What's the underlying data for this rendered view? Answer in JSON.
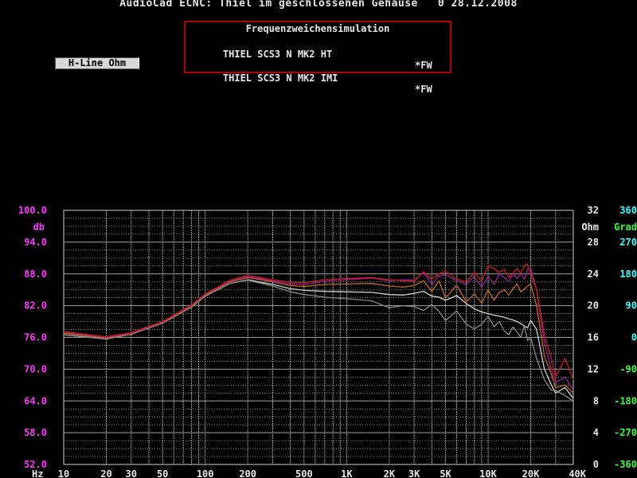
{
  "header": {
    "title": "AudioCad ECNC: Thiel im geschlossenen Gehäuse   0 28.12.2008"
  },
  "legend_box": {
    "heading": "Frequenzweichensimulation",
    "lines": [
      {
        "name": "THIEL SCS3 N MK2 HT",
        "tag": "*FW"
      },
      {
        "name": "THIEL SCS3 N MK2 IMI",
        "tag": "*FW"
      }
    ]
  },
  "toolbar": {
    "hline_label": "H-Line Ohm"
  },
  "colors": {
    "db_axis": "#ff33ff",
    "grad_axis": "#33ffff",
    "grad_neg_axis": "#33ff33",
    "grid": "#9a9a9a",
    "frame": "#d0d0d0",
    "legend_border": "#b00000"
  },
  "chart_data": {
    "type": "line",
    "x_scale": "log",
    "xlim": [
      10,
      40000
    ],
    "x_tick_labels": [
      {
        "value": 10,
        "label": "10"
      },
      {
        "value": 20,
        "label": "20"
      },
      {
        "value": 30,
        "label": "30"
      },
      {
        "value": 50,
        "label": "50"
      },
      {
        "value": 100,
        "label": "100"
      },
      {
        "value": 200,
        "label": "200"
      },
      {
        "value": 500,
        "label": "500"
      },
      {
        "value": 1000,
        "label": "1K"
      },
      {
        "value": 2000,
        "label": "2K"
      },
      {
        "value": 3000,
        "label": "3K"
      },
      {
        "value": 5000,
        "label": "5K"
      },
      {
        "value": 10000,
        "label": "10K"
      },
      {
        "value": 20000,
        "label": "20K"
      },
      {
        "value": 40000,
        "label": "40K"
      }
    ],
    "x_unit": "Hz",
    "ylim": [
      52,
      100
    ],
    "y_ticks": [
      52,
      58,
      64,
      70,
      76,
      82,
      88,
      94,
      100
    ],
    "y_tick_labels": [
      "52.0",
      "58.0",
      "64.0",
      "70.0",
      "76.0",
      "82.0",
      "88.0",
      "94.0",
      "100.0"
    ],
    "ylabel": "db",
    "ohm_axis": {
      "label": "Ohm",
      "ylim": [
        0,
        32
      ],
      "ticks": [
        "0",
        "4",
        "8",
        "12",
        "16",
        "20",
        "24",
        "28",
        "32"
      ]
    },
    "grad_axis": {
      "label": "Grad",
      "ylim": [
        -360,
        360
      ],
      "ticks": [
        "-360",
        "-270",
        "-180",
        "-90",
        "0",
        "90",
        "180",
        "270",
        "360"
      ]
    },
    "grid": true,
    "series": [
      {
        "color": "#d4d4d4",
        "x": [
          10,
          20,
          30,
          50,
          80,
          100,
          150,
          200,
          300,
          400,
          500,
          700,
          1000,
          1500,
          2000,
          2500,
          3000,
          3500,
          4000,
          4500,
          5000,
          6000,
          7000,
          8000,
          9000,
          10000,
          11000,
          12000,
          13000,
          14000,
          15000,
          16000,
          17000,
          18000,
          19000,
          20000,
          22000,
          25000,
          28000,
          30000,
          35000,
          40000
        ],
        "y": [
          76.5,
          75.7,
          76.6,
          78.7,
          81.7,
          83.8,
          86.2,
          86.9,
          86.0,
          85.2,
          84.9,
          84.7,
          84.6,
          84.5,
          84.1,
          84.0,
          84.3,
          84.7,
          83.8,
          83.6,
          83.0,
          83.9,
          82.4,
          81.4,
          80.8,
          80.5,
          80.2,
          80.0,
          79.8,
          79.5,
          79.3,
          79.0,
          78.6,
          78.2,
          77.8,
          79.2,
          77.5,
          70.0,
          67.0,
          65.5,
          66.5,
          64.5
        ]
      },
      {
        "color": "#8a8a8a",
        "x": [
          10,
          20,
          30,
          50,
          80,
          100,
          150,
          200,
          300,
          400,
          500,
          700,
          1000,
          1500,
          2000,
          2500,
          3000,
          3500,
          4000,
          4500,
          5000,
          6000,
          7000,
          8000,
          9000,
          10000,
          11000,
          12000,
          13000,
          14000,
          15000,
          16000,
          17000,
          18000,
          19000,
          20000,
          22000,
          25000,
          28000,
          30000,
          35000,
          40000
        ],
        "y": [
          76.5,
          75.7,
          76.6,
          78.7,
          81.7,
          83.8,
          86.2,
          86.8,
          85.7,
          84.6,
          84.1,
          83.6,
          83.3,
          82.9,
          81.6,
          82.0,
          81.8,
          81.1,
          82.2,
          80.9,
          79.2,
          81.0,
          78.5,
          77.6,
          78.5,
          80.0,
          78.0,
          79.0,
          77.2,
          76.5,
          78.0,
          77.0,
          76.0,
          78.2,
          75.4,
          76.0,
          72.0,
          68.0,
          66.0,
          66.0,
          65.0,
          64.0
        ]
      },
      {
        "color": "#c86a1a",
        "x": [
          10,
          20,
          30,
          50,
          80,
          100,
          150,
          200,
          300,
          400,
          500,
          700,
          1000,
          1500,
          2000,
          2500,
          3000,
          3500,
          4000,
          4500,
          5000,
          6000,
          7000,
          8000,
          9000,
          10000,
          11000,
          12000,
          13000,
          14000,
          15000,
          16000,
          17000,
          18000,
          19000,
          20000,
          22000,
          25000,
          28000,
          30000,
          35000,
          40000
        ],
        "y": [
          76.8,
          75.9,
          76.7,
          78.8,
          81.9,
          84.0,
          86.5,
          87.3,
          86.5,
          85.8,
          85.6,
          86.0,
          86.1,
          86.2,
          85.7,
          85.5,
          85.8,
          86.7,
          84.7,
          86.7,
          83.4,
          85.9,
          82.7,
          84.2,
          82.5,
          85.0,
          83.0,
          84.5,
          85.0,
          84.0,
          85.2,
          86.1,
          84.6,
          85.1,
          85.7,
          86.1,
          82.0,
          72.5,
          69.0,
          66.5,
          67.0,
          65.5
        ]
      },
      {
        "color": "#9a1a9a",
        "x": [
          10,
          20,
          30,
          50,
          80,
          100,
          150,
          200,
          300,
          400,
          500,
          700,
          1000,
          1500,
          2000,
          2500,
          3000,
          3500,
          4000,
          4500,
          5000,
          6000,
          7000,
          8000,
          9000,
          10000,
          11000,
          12000,
          13000,
          14000,
          15000,
          16000,
          17000,
          18000,
          19000,
          20000,
          22000,
          25000,
          28000,
          30000,
          35000,
          40000
        ],
        "y": [
          77.0,
          76.0,
          76.8,
          78.9,
          82.0,
          84.1,
          86.7,
          87.5,
          86.7,
          86.1,
          86.0,
          86.6,
          86.9,
          87.2,
          86.7,
          86.9,
          86.8,
          88.2,
          86.0,
          87.6,
          87.8,
          86.7,
          86.0,
          87.5,
          85.5,
          87.5,
          86.0,
          88.0,
          87.3,
          86.6,
          88.0,
          87.1,
          88.0,
          87.0,
          88.8,
          89.0,
          85.0,
          75.0,
          70.0,
          67.5,
          68.5,
          66.0
        ]
      },
      {
        "color": "#cc1a1a",
        "x": [
          10,
          20,
          30,
          50,
          80,
          100,
          150,
          200,
          300,
          400,
          500,
          700,
          1000,
          1500,
          2000,
          2500,
          3000,
          3500,
          4000,
          4500,
          5000,
          6000,
          7000,
          8000,
          9000,
          10000,
          11000,
          12000,
          13000,
          14000,
          15000,
          16000,
          17000,
          18000,
          19000,
          20000,
          22000,
          25000,
          28000,
          30000,
          35000,
          40000
        ],
        "y": [
          77.1,
          76.1,
          76.9,
          79.0,
          82.1,
          84.2,
          86.8,
          87.7,
          86.9,
          86.4,
          86.3,
          86.9,
          87.1,
          87.3,
          86.9,
          86.7,
          86.6,
          88.4,
          87.0,
          88.0,
          88.5,
          87.0,
          86.5,
          88.3,
          86.6,
          89.5,
          89.0,
          88.3,
          88.8,
          87.3,
          88.2,
          89.0,
          88.1,
          89.6,
          89.8,
          88.0,
          85.0,
          76.5,
          72.0,
          68.5,
          72.0,
          68.0
        ]
      }
    ]
  }
}
